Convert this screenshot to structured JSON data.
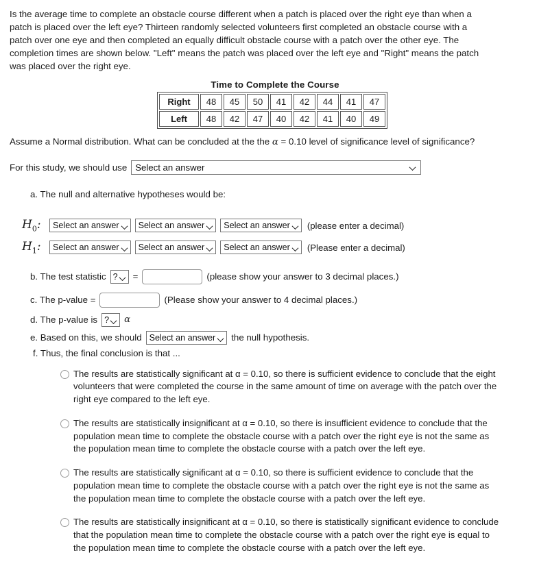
{
  "intro": {
    "paragraph": "Is the average time to complete an obstacle course different when a patch is placed over the right eye than when a patch is placed over the left eye? Thirteen randomly selected volunteers first completed an obstacle course with a patch over one eye and then completed an equally difficult obstacle course with a patch over the other eye. The completion times are shown below. \"Left\" means the patch was placed over the left eye and \"Right\" means the patch was placed over the right eye."
  },
  "table": {
    "title": "Time to Complete the Course",
    "rows": [
      {
        "label": "Right",
        "values": [
          48,
          45,
          50,
          41,
          42,
          44,
          41,
          47
        ]
      },
      {
        "label": "Left",
        "values": [
          48,
          42,
          47,
          40,
          42,
          41,
          40,
          49
        ]
      }
    ]
  },
  "assume": {
    "text_before": "Assume a Normal distribution.  What can be concluded at the the ",
    "alpha": "α",
    "text_after": " = 0.10 level of significance level of significance?"
  },
  "study": {
    "prompt": "For this study, we should use",
    "select_value": "Select an answer"
  },
  "parts": {
    "a": "a. The null and alternative hypotheses would be:",
    "b_prefix": "b. The test statistic",
    "b_question": "?",
    "b_equals": "=",
    "b_note": "(please show your answer to 3 decimal places.)",
    "c_prefix": "c. The p-value =",
    "c_note": "(Please show your answer to 4 decimal places.)",
    "d_prefix": "d. The p-value is",
    "d_question": "?",
    "d_alpha": "α",
    "e_prefix": "e. Based on this, we should",
    "e_select": "Select an answer",
    "e_suffix": "the null hypothesis.",
    "f": "f. Thus, the final conclusion is that ..."
  },
  "hypotheses": {
    "h0_label": "H",
    "h0_sub": "0",
    "h1_label": "H",
    "h1_sub": "1",
    "colon": ":",
    "select_value": "Select an answer",
    "h0_note": "(please enter a decimal)",
    "h1_note": "(Please enter a decimal)"
  },
  "conclusion_options": [
    "The results are statistically significant at α = 0.10, so there is sufficient evidence to conclude that the eight volunteers that were completed the course in the same amount of time on average with the patch over the right eye compared to the left eye.",
    "The results are statistically insignificant at α = 0.10, so there is insufficient evidence to conclude that the population mean time to complete the obstacle course with a patch over the right eye is not the same as the population mean time to complete the obstacle course with a patch over the left eye.",
    "The results are statistically significant at α = 0.10, so there is sufficient evidence to conclude that the population mean time to complete the obstacle course with a patch over the right eye is not the same as the population mean time to complete the obstacle course with a patch over the left eye.",
    "The results are statistically insignificant at α = 0.10, so there is statistically significant evidence to conclude that the population mean time to complete the obstacle course with a patch over the right eye is equal to the population mean time to complete the obstacle course with a patch over the left eye."
  ],
  "colors": {
    "text": "#1b1b1b",
    "border": "#767676",
    "input_border": "#949494"
  }
}
